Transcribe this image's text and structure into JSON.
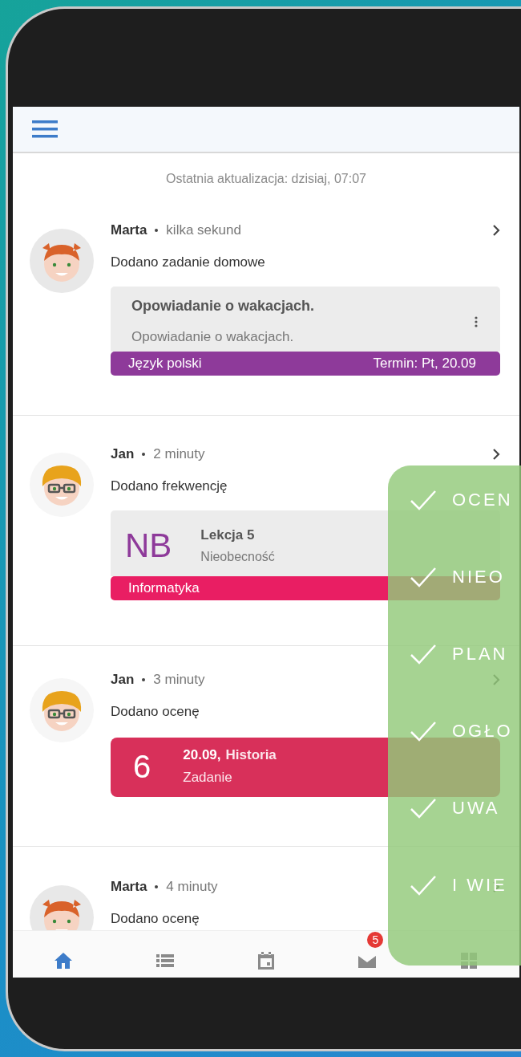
{
  "last_update": "Ostatnia aktualizacja: dzisiaj, 07:07",
  "feed": [
    {
      "author": "Marta",
      "kind": "girl",
      "time": "kilka sekund",
      "action": "Dodano zadanie domowe",
      "card": {
        "kind": "homework",
        "title": "Opowiadanie o wakacjach.",
        "description": "Opowiadanie o wakacjach.",
        "subject": "Język polski",
        "due": "Termin: Pt, 20.09",
        "color": "#8e3a9a"
      }
    },
    {
      "author": "Jan",
      "kind": "boy",
      "time": "2 minuty",
      "action": "Dodano frekwencję",
      "card": {
        "kind": "attendance",
        "code": "NB",
        "title": "Lekcja 5",
        "description": "Nieobecność",
        "subject": "Informatyka",
        "color": "#e91e63"
      }
    },
    {
      "author": "Jan",
      "kind": "boy",
      "time": "3 minuty",
      "action": "Dodano ocenę",
      "card": {
        "kind": "grade",
        "grade": "6",
        "date": "20.09,",
        "subject": "Historia",
        "description": "Zadanie",
        "color": "#d8305a"
      }
    },
    {
      "author": "Marta",
      "kind": "girl",
      "time": "4 minuty",
      "action": "Dodano ocenę"
    }
  ],
  "nav": [
    {
      "selected": true
    },
    {
      "selected": false
    },
    {
      "selected": false
    },
    {
      "selected": false,
      "badge": "5"
    },
    {
      "selected": false
    }
  ],
  "features": [
    "OCEN",
    "NIEO",
    "PLAN",
    "OGŁO",
    "UWA",
    "I WIE"
  ]
}
